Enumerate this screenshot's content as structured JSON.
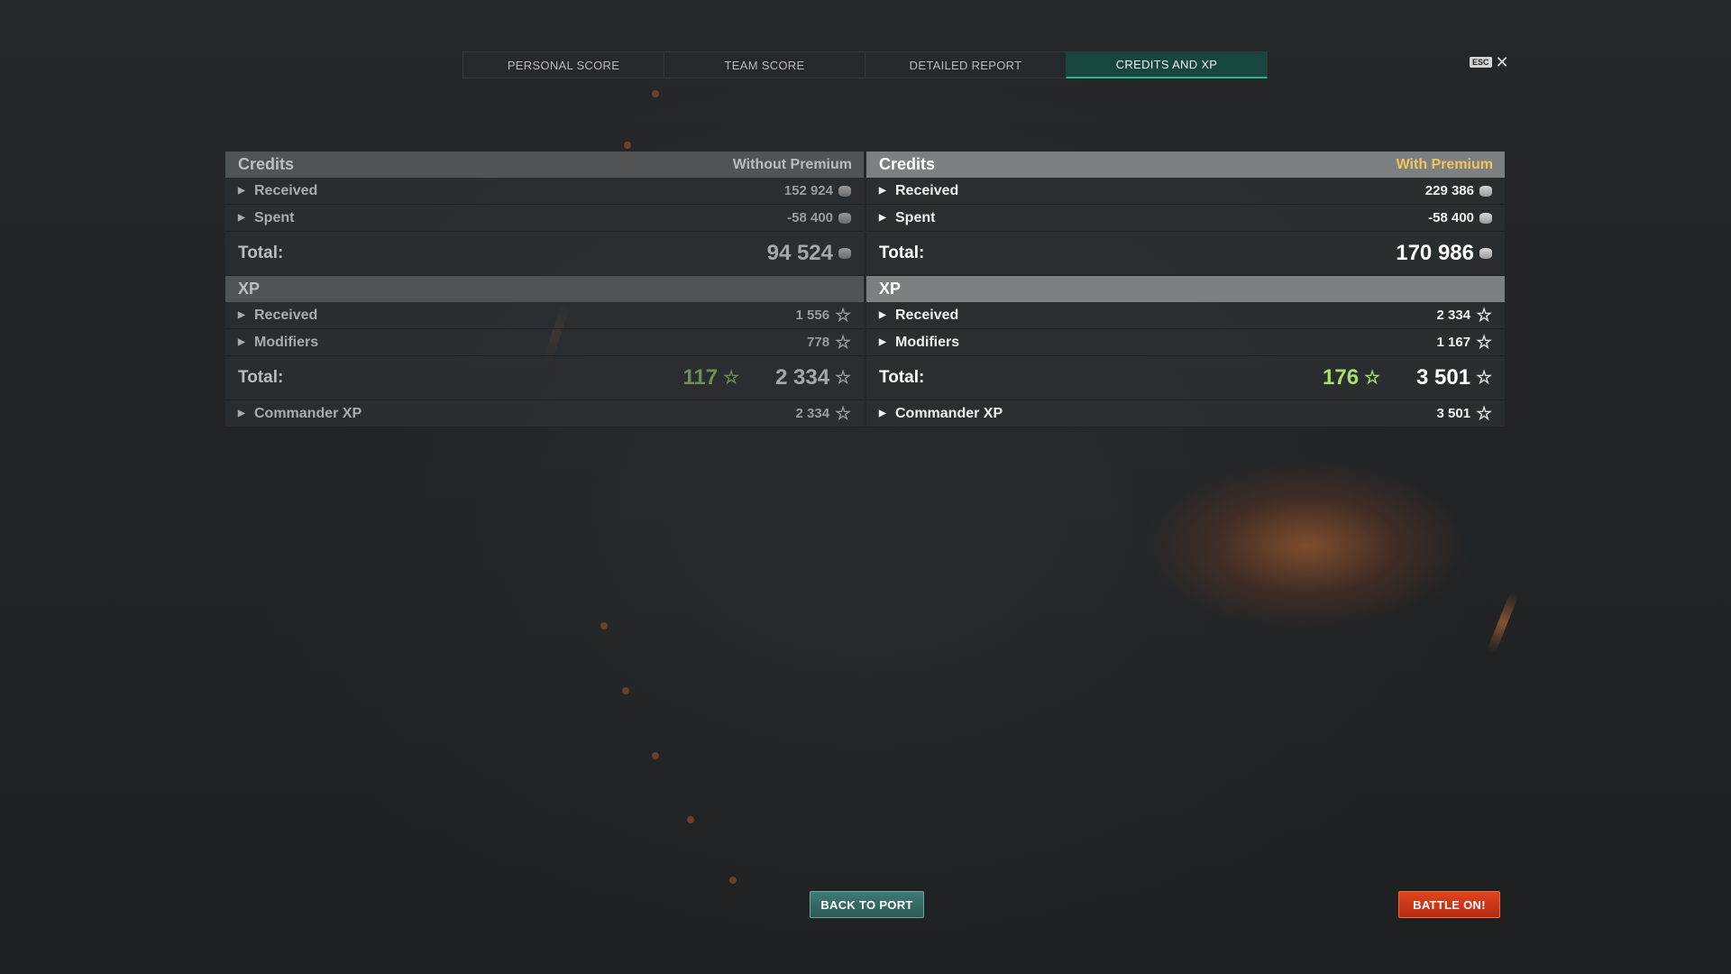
{
  "tabs": [
    {
      "label": "PERSONAL SCORE",
      "active": false
    },
    {
      "label": "TEAM SCORE",
      "active": false
    },
    {
      "label": "DETAILED REPORT",
      "active": false
    },
    {
      "label": "CREDITS AND XP",
      "active": true
    }
  ],
  "close": {
    "esc_label": "ESC",
    "icon": "close-icon"
  },
  "left_panel": {
    "credits_title": "Credits",
    "premium_label": "Without Premium",
    "credits_rows": [
      {
        "label": "Received",
        "value": "152 924"
      },
      {
        "label": "Spent",
        "value": "-58 400"
      }
    ],
    "credits_total_label": "Total:",
    "credits_total_value": "94 524",
    "xp_title": "XP",
    "xp_rows": [
      {
        "label": "Received",
        "value": "1 556"
      },
      {
        "label": "Modifiers",
        "value": "778"
      }
    ],
    "xp_total_label": "Total:",
    "xp_bonus_value": "117",
    "xp_total_value": "2 334",
    "commander_label": "Commander XP",
    "commander_value": "2 334"
  },
  "right_panel": {
    "credits_title": "Credits",
    "premium_label": "With Premium",
    "credits_rows": [
      {
        "label": "Received",
        "value": "229 386"
      },
      {
        "label": "Spent",
        "value": "-58 400"
      }
    ],
    "credits_total_label": "Total:",
    "credits_total_value": "170 986",
    "xp_title": "XP",
    "xp_rows": [
      {
        "label": "Received",
        "value": "2 334"
      },
      {
        "label": "Modifiers",
        "value": "1 167"
      }
    ],
    "xp_total_label": "Total:",
    "xp_bonus_value": "176",
    "xp_total_value": "3 501",
    "commander_label": "Commander XP",
    "commander_value": "3 501"
  },
  "buttons": {
    "back_to_port": "BACK TO PORT",
    "battle_on": "BATTLE ON!"
  },
  "colors": {
    "premium_accent": "#f4c45a",
    "active_tab": "#17463f",
    "xp_bonus": "#a9e06b",
    "battle_button": "#d2381a",
    "port_button": "#336a64"
  }
}
